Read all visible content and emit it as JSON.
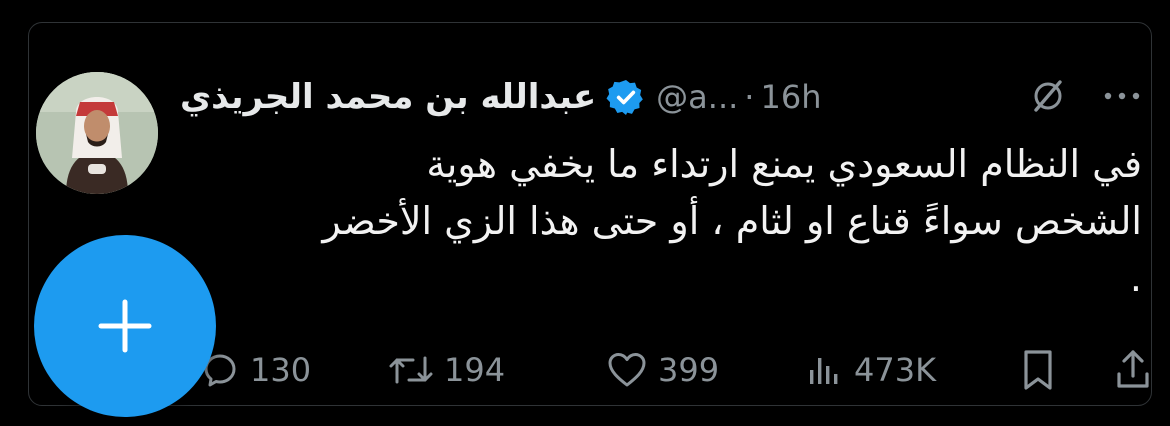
{
  "tweet": {
    "display_name": "عبدالله بن محمد الجريذي",
    "handle": "@a...",
    "separator": "·",
    "time": "16h",
    "text_lines": [
      "في النظام السعودي يمنع ارتداء ما يخفي هوية",
      "الشخص سواءً قناع او لثام ، أو حتى هذا الزي الأخضر",
      "."
    ]
  },
  "actions": {
    "replies": "130",
    "retweets": "194",
    "likes": "399",
    "views": "473K"
  },
  "icons": {
    "verified": "verified-badge-icon",
    "grok": "grok-icon",
    "more": "more-icon",
    "reply": "reply-icon",
    "retweet": "retweet-icon",
    "like": "heart-icon",
    "views": "views-icon",
    "bookmark": "bookmark-icon",
    "share": "share-icon",
    "fab": "plus-icon"
  },
  "colors": {
    "background": "#000000",
    "text": "#e7e9ea",
    "muted": "#8b9399",
    "accent": "#1d9bf0"
  }
}
